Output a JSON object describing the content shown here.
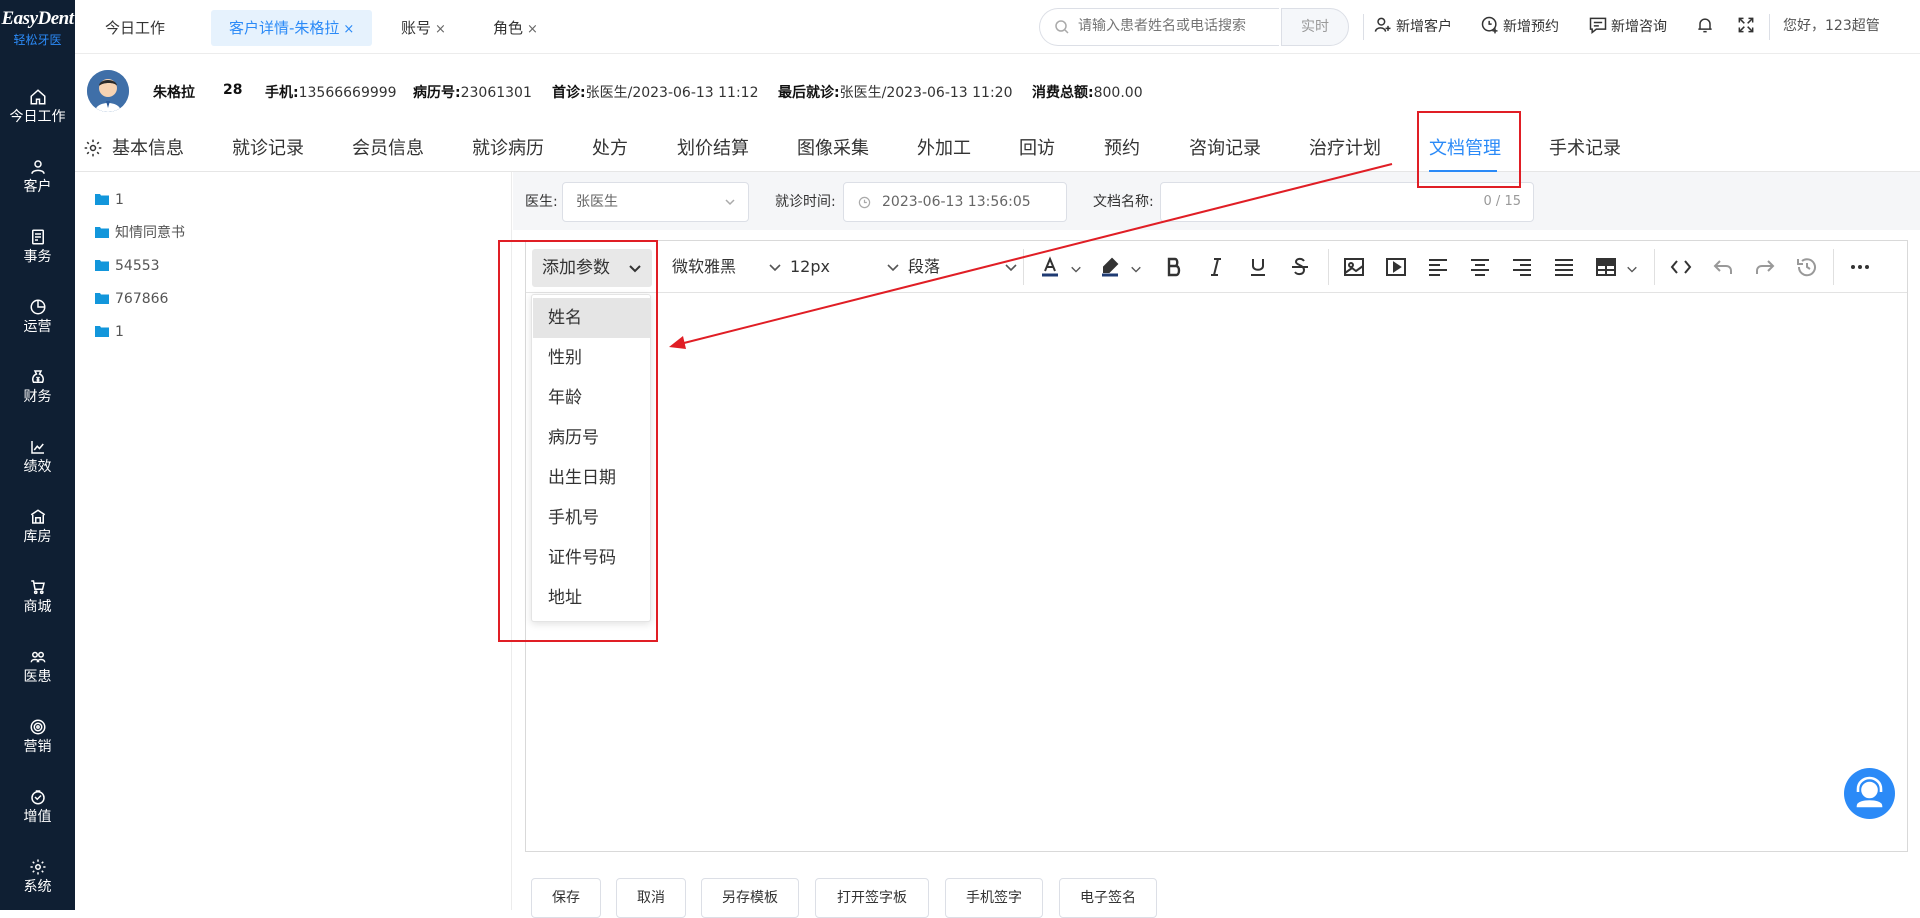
{
  "logo": {
    "main": "EasyDent",
    "sub": "轻松牙医"
  },
  "sidebar": {
    "items": [
      {
        "label": "今日工作",
        "icon": "home-icon"
      },
      {
        "label": "客户",
        "icon": "user-icon"
      },
      {
        "label": "事务",
        "icon": "task-icon"
      },
      {
        "label": "运营",
        "icon": "pie-icon"
      },
      {
        "label": "财务",
        "icon": "finance-icon"
      },
      {
        "label": "绩效",
        "icon": "chart-icon"
      },
      {
        "label": "库房",
        "icon": "warehouse-icon"
      },
      {
        "label": "商城",
        "icon": "cart-icon"
      },
      {
        "label": "医患",
        "icon": "doctor-patient-icon"
      },
      {
        "label": "营销",
        "icon": "target-icon"
      },
      {
        "label": "增值",
        "icon": "value-icon"
      },
      {
        "label": "系统",
        "icon": "gear-icon"
      }
    ]
  },
  "topbar": {
    "tabs": [
      {
        "label": "今日工作",
        "closable": false
      },
      {
        "label": "客户详情-朱格拉",
        "closable": true,
        "active": true
      },
      {
        "label": "账号",
        "closable": true
      },
      {
        "label": "角色",
        "closable": true
      }
    ],
    "close_symbol": "×",
    "search": {
      "placeholder": "请输入患者姓名或电话搜索",
      "button": "实时"
    },
    "tools": {
      "new_customer": "新增客户",
      "new_appointment": "新增预约",
      "new_consult": "新增咨询"
    },
    "greeting": "您好，123超管"
  },
  "patient": {
    "name": "朱格拉",
    "age": "28",
    "phone_label": "手机:",
    "phone": "13566669999",
    "record_label": "病历号:",
    "record": "23061301",
    "first_visit_label": "首诊:",
    "first_visit": "张医生/2023-06-13 11:12",
    "last_visit_label": "最后就诊:",
    "last_visit": "张医生/2023-06-13 11:20",
    "total_label": "消费总额:",
    "total": "800.00"
  },
  "subtabs": {
    "items": [
      "基本信息",
      "就诊记录",
      "会员信息",
      "就诊病历",
      "处方",
      "划价结算",
      "图像采集",
      "外加工",
      "回访",
      "预约",
      "咨询记录",
      "治疗计划",
      "文档管理",
      "手术记录"
    ],
    "active": "文档管理"
  },
  "tree": {
    "items": [
      "1",
      "知情同意书",
      "54553",
      "767866",
      "1"
    ]
  },
  "form": {
    "doctor_label": "医生:",
    "doctor_value": "张医生",
    "visit_time_label": "就诊时间:",
    "visit_time_value": "2023-06-13 13:56:05",
    "doc_name_label": "文档名称:",
    "doc_name_counter": "0 / 15"
  },
  "toolbar": {
    "add_param": "添加参数",
    "font_family": "微软雅黑",
    "font_size": "12px",
    "block_format": "段落"
  },
  "dropdown": {
    "items": [
      "姓名",
      "性别",
      "年龄",
      "病历号",
      "出生日期",
      "手机号",
      "证件号码",
      "地址"
    ],
    "highlighted": "姓名"
  },
  "bottom_buttons": [
    "保存",
    "取消",
    "另存模板",
    "打开签字板",
    "手机签字",
    "电子签名"
  ],
  "colors": {
    "sidebar_bg": "#0f1f33",
    "accent": "#2b8af7",
    "annotation": "#e01e25"
  }
}
